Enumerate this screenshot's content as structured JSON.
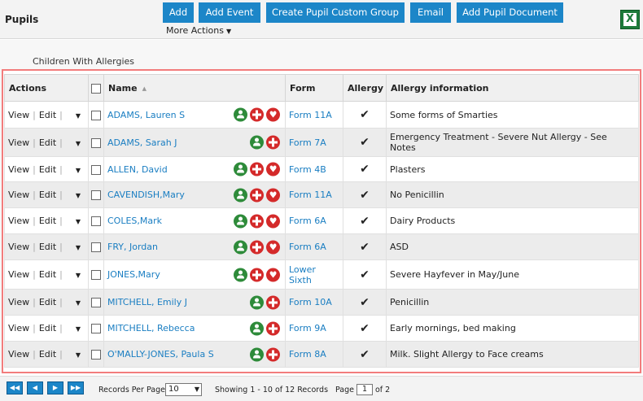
{
  "header": {
    "title": "Pupils",
    "buttons": [
      {
        "label": "Add"
      },
      {
        "label": "Add Event"
      },
      {
        "label": "Create Pupil Custom Group"
      },
      {
        "label": "Email"
      },
      {
        "label": "Add Pupil Document"
      }
    ],
    "more_actions": "More Actions",
    "excel_icon": "excel-export-icon"
  },
  "grid": {
    "caption": "Children With Allergies",
    "columns": [
      "Actions",
      "",
      "Name",
      "Form",
      "Allergy",
      "Allergy information"
    ],
    "action_view": "View",
    "action_edit": "Edit",
    "rows": [
      {
        "name": "ADAMS, Lauren S",
        "form": "Form 11A",
        "info": "Some forms of Smarties",
        "icons": [
          "person",
          "medical",
          "allergy"
        ]
      },
      {
        "name": "ADAMS, Sarah J",
        "form": "Form 7A",
        "info": "Emergency Treatment - Severe Nut Allergy - See Notes",
        "icons": [
          "person",
          "medical"
        ]
      },
      {
        "name": "ALLEN, David",
        "form": "Form 4B",
        "info": "Plasters",
        "icons": [
          "person",
          "medical",
          "allergy"
        ]
      },
      {
        "name": "CAVENDISH,Mary",
        "form": "Form 11A",
        "info": "No Penicillin",
        "icons": [
          "person",
          "medical",
          "allergy"
        ]
      },
      {
        "name": "COLES,Mark",
        "form": "Form 6A",
        "info": "Dairy Products",
        "icons": [
          "person",
          "medical",
          "allergy"
        ]
      },
      {
        "name": "FRY, Jordan",
        "form": "Form 6A",
        "info": "ASD",
        "icons": [
          "person",
          "medical",
          "allergy"
        ]
      },
      {
        "name": "JONES,Mary",
        "form": "Lower Sixth",
        "info": "Severe Hayfever in May/June",
        "icons": [
          "person",
          "medical",
          "allergy"
        ]
      },
      {
        "name": "MITCHELL, Emily J",
        "form": "Form 10A",
        "info": "Penicillin",
        "icons": [
          "person",
          "medical"
        ]
      },
      {
        "name": "MITCHELL, Rebecca",
        "form": "Form 9A",
        "info": "Early mornings, bed making",
        "icons": [
          "person",
          "medical"
        ]
      },
      {
        "name": "O'MALLY-JONES, Paula S",
        "form": "Form 8A",
        "info": "Milk. Slight Allergy to Face creams",
        "icons": [
          "person",
          "medical"
        ]
      }
    ]
  },
  "pager": {
    "records_per_page_label": "Records Per Page",
    "records_per_page": "10",
    "showing": "Showing 1 - 10 of 12 Records",
    "page_label": "Page",
    "page": "1",
    "of_pages": "of 2",
    "buttons": [
      "first-page-icon",
      "prev-page-icon",
      "next-page-icon",
      "last-page-icon"
    ]
  },
  "colors": {
    "accent": "#1c86c8",
    "link": "#1a7ec2",
    "frame": "#f27c7c",
    "person_icon": "#2e8b3a",
    "medical_icon": "#d42a2a"
  }
}
